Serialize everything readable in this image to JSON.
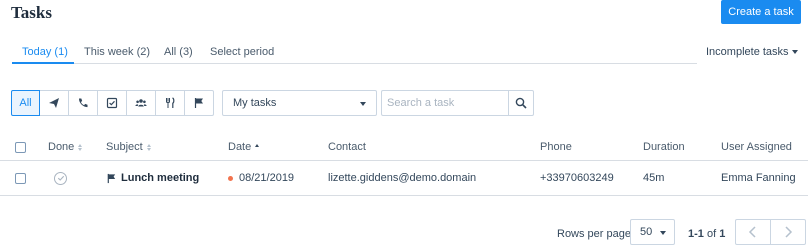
{
  "header": {
    "title": "Tasks",
    "create_button": "Create a task"
  },
  "tabs": [
    {
      "label": "Today (1)",
      "active": true
    },
    {
      "label": "This week (2)",
      "active": false
    },
    {
      "label": "All (3)",
      "active": false
    },
    {
      "label": "Select period",
      "active": false
    }
  ],
  "status_filter": {
    "label": "Incomplete tasks"
  },
  "type_filters": [
    {
      "label": "All",
      "icon": "all",
      "active": true
    },
    {
      "label": "",
      "icon": "send-icon"
    },
    {
      "label": "",
      "icon": "phone-icon"
    },
    {
      "label": "",
      "icon": "checkbox-icon"
    },
    {
      "label": "",
      "icon": "users-icon"
    },
    {
      "label": "",
      "icon": "cutlery-icon"
    },
    {
      "label": "",
      "icon": "flag-icon"
    }
  ],
  "owner_select": {
    "value": "My tasks"
  },
  "search": {
    "placeholder": "Search a task"
  },
  "table": {
    "columns": [
      "Done",
      "Subject",
      "Date",
      "Contact",
      "Phone",
      "Duration",
      "User Assigned"
    ],
    "rows": [
      {
        "done": false,
        "subject": "Lunch meeting",
        "date": "08/21/2019",
        "contact": "lizette.giddens@demo.domain",
        "phone": "+33970603249",
        "duration": "45m",
        "user": "Emma Fanning"
      }
    ]
  },
  "pagination": {
    "rows_per_page_label": "Rows per page",
    "rows_per_page": "50",
    "range": "1-1",
    "of_label": "of",
    "total": "1"
  },
  "colors": {
    "accent": "#1a8bf0",
    "overdue_dot": "#f2734e"
  }
}
